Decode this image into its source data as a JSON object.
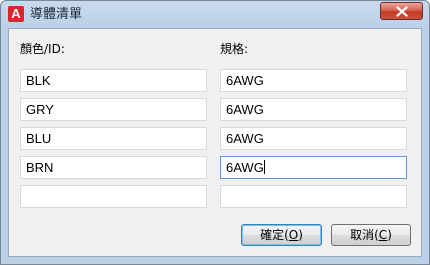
{
  "window": {
    "title": "導體清單",
    "app_icon_letter": "A"
  },
  "labels": {
    "color_id": "顏色/ID:",
    "spec": "規格:"
  },
  "rows": [
    {
      "color": "BLK",
      "spec": "6AWG"
    },
    {
      "color": "GRY",
      "spec": "6AWG"
    },
    {
      "color": "BLU",
      "spec": "6AWG"
    },
    {
      "color": "BRN",
      "spec": "6AWG"
    },
    {
      "color": "",
      "spec": ""
    }
  ],
  "buttons": {
    "ok_text": "確定(",
    "ok_key": "O",
    "ok_tail": ")",
    "cancel_text": "取消(",
    "cancel_key": "C",
    "cancel_tail": ")"
  }
}
